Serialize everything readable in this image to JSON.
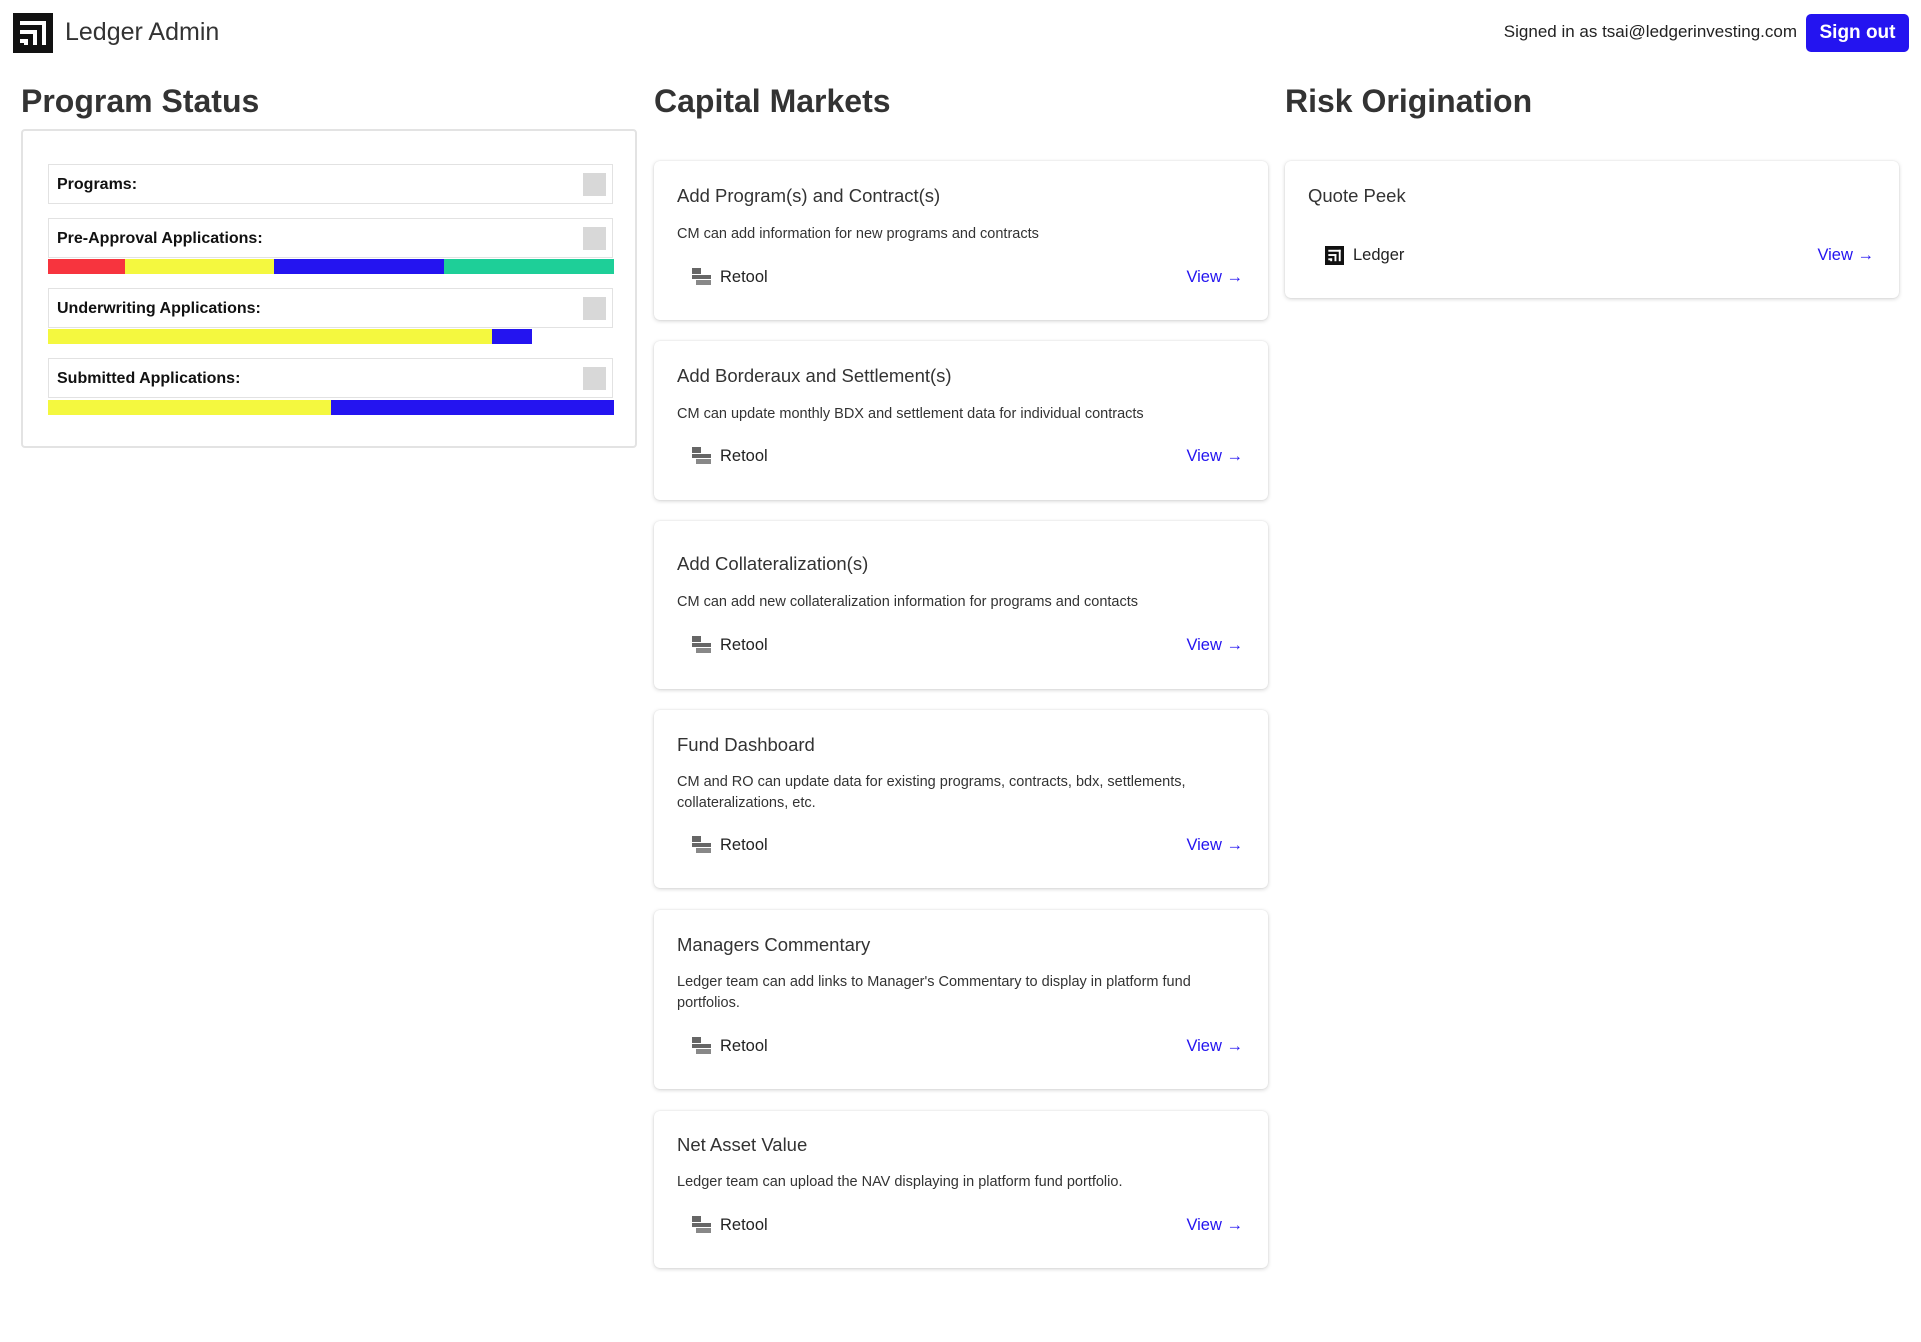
{
  "header": {
    "app_title": "Ledger Admin",
    "signed_in_text": "Signed in as tsai@ledgerinvesting.com",
    "sign_out_label": "Sign out",
    "logo_icon": "ledger-logo-icon"
  },
  "colors": {
    "accent": "#2414f0",
    "red": "#f7343e",
    "yellow": "#f4f83f",
    "blue": "#2414f0",
    "green": "#1ecf98"
  },
  "program_status": {
    "title": "Program Status",
    "rows": [
      {
        "label": "Programs:",
        "segments": []
      },
      {
        "label": "Pre-Approval Applications:",
        "segments": [
          {
            "color": "red",
            "fraction": 0.136
          },
          {
            "color": "yellow",
            "fraction": 0.263
          },
          {
            "color": "blue",
            "fraction": 0.301
          },
          {
            "color": "green",
            "fraction": 0.3
          }
        ]
      },
      {
        "label": "Underwriting Applications:",
        "segments": [
          {
            "color": "yellow",
            "fraction": 0.785
          },
          {
            "color": "blue",
            "fraction": 0.071
          }
        ]
      },
      {
        "label": "Submitted Applications:",
        "segments": [
          {
            "color": "yellow",
            "fraction": 0.5
          },
          {
            "color": "blue",
            "fraction": 0.5
          }
        ]
      }
    ]
  },
  "capital_markets": {
    "title": "Capital Markets",
    "cards": [
      {
        "title": "Add Program(s) and Contract(s)",
        "description": "CM can add information for new programs and contracts",
        "tool": "Retool",
        "tool_icon": "retool-icon",
        "link": "View →"
      },
      {
        "title": "Add Borderaux and Settlement(s)",
        "description": "CM can update monthly BDX and settlement data for individual contracts",
        "tool": "Retool",
        "tool_icon": "retool-icon",
        "link": "View →"
      },
      {
        "title": "Add Collateralization(s)",
        "description": "CM can add new collateralization information for programs and contacts",
        "tool": "Retool",
        "tool_icon": "retool-icon",
        "link": "View →"
      },
      {
        "title": "Fund Dashboard",
        "description": "CM and RO can update data for existing programs, contracts, bdx, settlements, collateralizations, etc.",
        "tool": "Retool",
        "tool_icon": "retool-icon",
        "link": "View →"
      },
      {
        "title": "Managers Commentary",
        "description": "Ledger team can add links to Manager's Commentary to display in platform fund portfolios.",
        "tool": "Retool",
        "tool_icon": "retool-icon",
        "link": "View →"
      },
      {
        "title": "Net Asset Value",
        "description": "Ledger team can upload the NAV displaying in platform fund portfolio.",
        "tool": "Retool",
        "tool_icon": "retool-icon",
        "link": "View →"
      }
    ]
  },
  "risk_origination": {
    "title": "Risk Origination",
    "cards": [
      {
        "title": "Quote Peek",
        "tool": "Ledger",
        "tool_icon": "ledger-logo-icon",
        "link": "View →"
      }
    ]
  }
}
